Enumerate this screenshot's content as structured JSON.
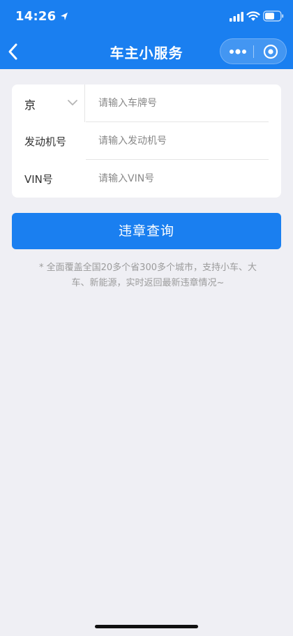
{
  "status_bar": {
    "time": "14:26"
  },
  "nav": {
    "title": "车主小服务",
    "icons": {
      "back": "chevron-left-icon",
      "more": "more-dots-icon",
      "close": "target-circle-icon"
    }
  },
  "form": {
    "province": {
      "value": "京"
    },
    "plate": {
      "placeholder": "请输入车牌号"
    },
    "engine": {
      "label": "发动机号",
      "placeholder": "请输入发动机号"
    },
    "vin": {
      "label": "VIN号",
      "placeholder": "请输入VIN号"
    }
  },
  "query_button": {
    "label": "违章查询"
  },
  "hint": "* 全面覆盖全国20多个省300多个城市，支持小车、大车、新能源，实时返回最新违章情况~",
  "colors": {
    "brand": "#1a7ff0",
    "background": "#efeff4",
    "card": "#ffffff"
  }
}
